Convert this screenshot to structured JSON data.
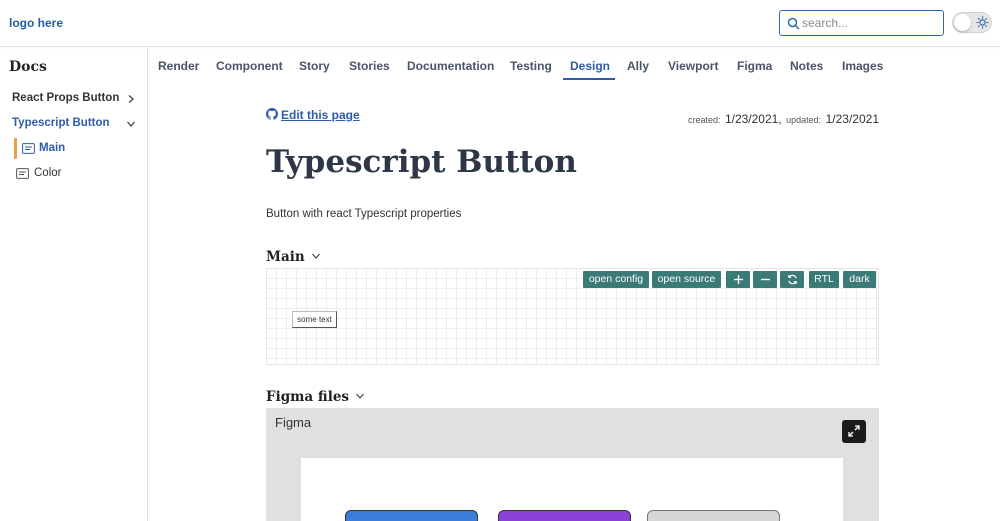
{
  "header": {
    "logo": "logo here",
    "search_placeholder": "search..."
  },
  "sidebar": {
    "title": "Docs",
    "items": [
      {
        "label": "React Props Button",
        "expanded": false
      },
      {
        "label": "Typescript Button",
        "expanded": true,
        "children": [
          {
            "label": "Main",
            "selected": true
          },
          {
            "label": "Color",
            "selected": false
          }
        ]
      }
    ]
  },
  "tabs": [
    "Render",
    "Component",
    "Story",
    "Stories",
    "Documentation",
    "Testing",
    "Design",
    "Ally",
    "Viewport",
    "Figma",
    "Notes",
    "Images"
  ],
  "active_tab": "Design",
  "page": {
    "edit_link": "Edit this page",
    "created_label": "created:",
    "created": "1/23/2021,",
    "updated_label": "updated:",
    "updated": "1/23/2021",
    "title": "Typescript Button",
    "description": "Button with react Typescript properties"
  },
  "main_section": {
    "title": "Main",
    "toolbar": {
      "open_config": "open config",
      "open_source": "open source",
      "zoom_in": "+",
      "zoom_out": "−",
      "rtl": "RTL",
      "dark": "dark"
    },
    "sample_text": "some text"
  },
  "figma_section": {
    "title": "Figma files",
    "panel_label": "Figma"
  },
  "colors": {
    "accent": "#2f5ba8",
    "toolbar_button": "#3a7a77",
    "active_marker": "#e6a04a",
    "figma_button_blue": "#3b7ddb",
    "figma_button_purple": "#8a43d6",
    "figma_button_gray": "#d6d6d6"
  }
}
